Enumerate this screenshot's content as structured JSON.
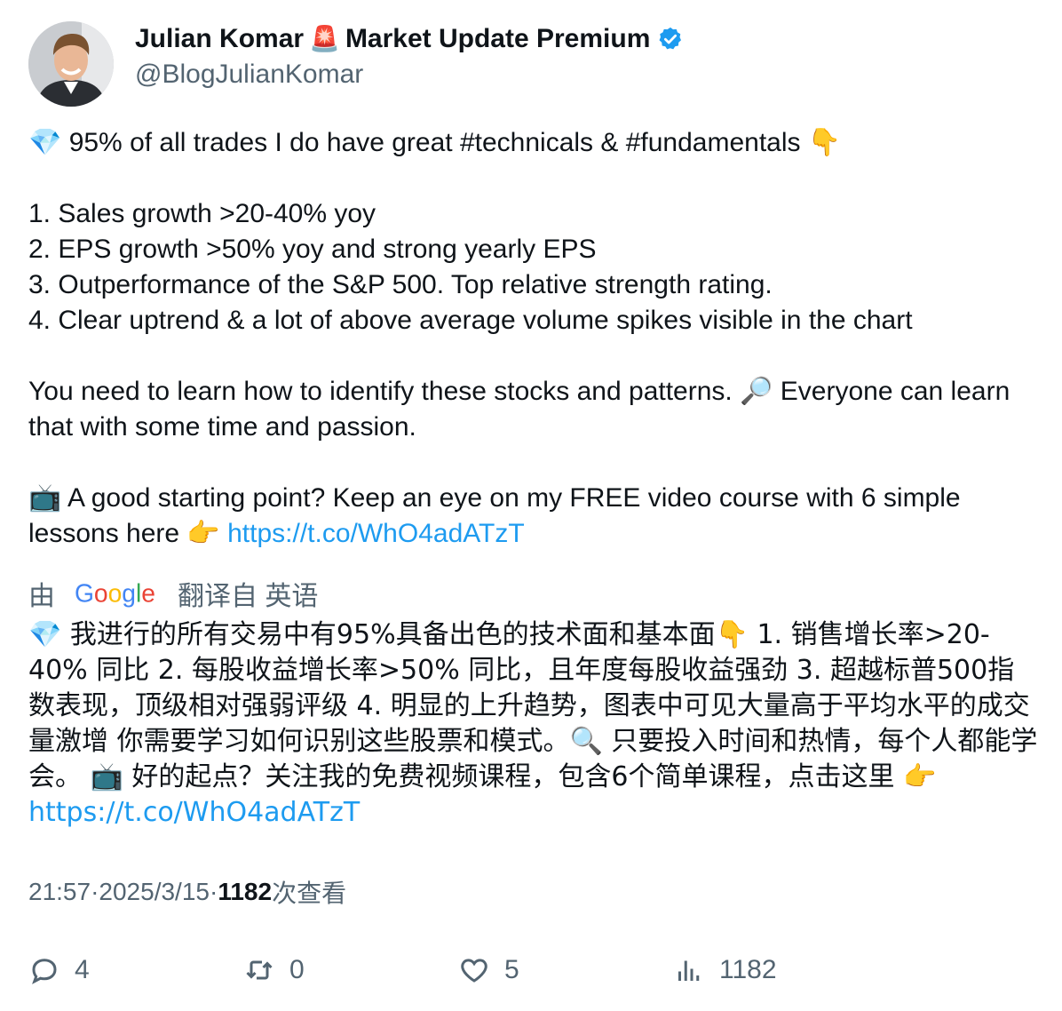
{
  "author": {
    "display_name": "Julian Komar",
    "badge_emoji": "🚨",
    "display_name_suffix": "Market Update Premium",
    "handle": "@BlogJulianKomar",
    "verified_color": "#1d9bf0"
  },
  "tweet": {
    "text": "💎 95% of all trades I do have great #technicals & #fundamentals 👇\n\n1. Sales growth >20-40% yoy\n2. EPS growth >50% yoy and strong yearly EPS\n3. Outperformance of the S&P 500. Top relative strength rating.\n4. Clear uptrend & a lot of above average volume spikes visible in the chart\n\nYou need to learn how to identify these stocks and patterns. 🔎 Everyone can learn that with some time and passion.\n\n📺 A good starting point? Keep an eye on my FREE video course with 6 simple lessons here 👉 ",
    "link": "https://t.co/WhO4adATzT"
  },
  "translation": {
    "by_label": "由",
    "provider": "Google",
    "from_label": "翻译自 英语",
    "text": "💎 我进行的所有交易中有95%具备出色的技术面和基本面👇 1. 销售增长率>20-40% 同比 2. 每股收益增长率>50% 同比，且年度每股收益强劲 3. 超越标普500指数表现，顶级相对强弱评级 4. 明显的上升趋势，图表中可见大量高于平均水平的成交量激增 你需要学习如何识别这些股票和模式。🔍 只要投入时间和热情，每个人都能学会。 📺 好的起点？关注我的免费视频课程，包含6个简单课程，点击这里 👉 ",
    "link": "https://t.co/WhO4adATzT"
  },
  "meta": {
    "time": "21:57",
    "separator": " · ",
    "date": "2025/3/15",
    "views_count": "1182",
    "views_label": "次查看"
  },
  "actions": {
    "replies": "4",
    "reposts": "0",
    "likes": "5",
    "views": "1182"
  },
  "colors": {
    "link": "#1d9bf0",
    "secondary_text": "#536471",
    "primary_text": "#0f1419"
  }
}
